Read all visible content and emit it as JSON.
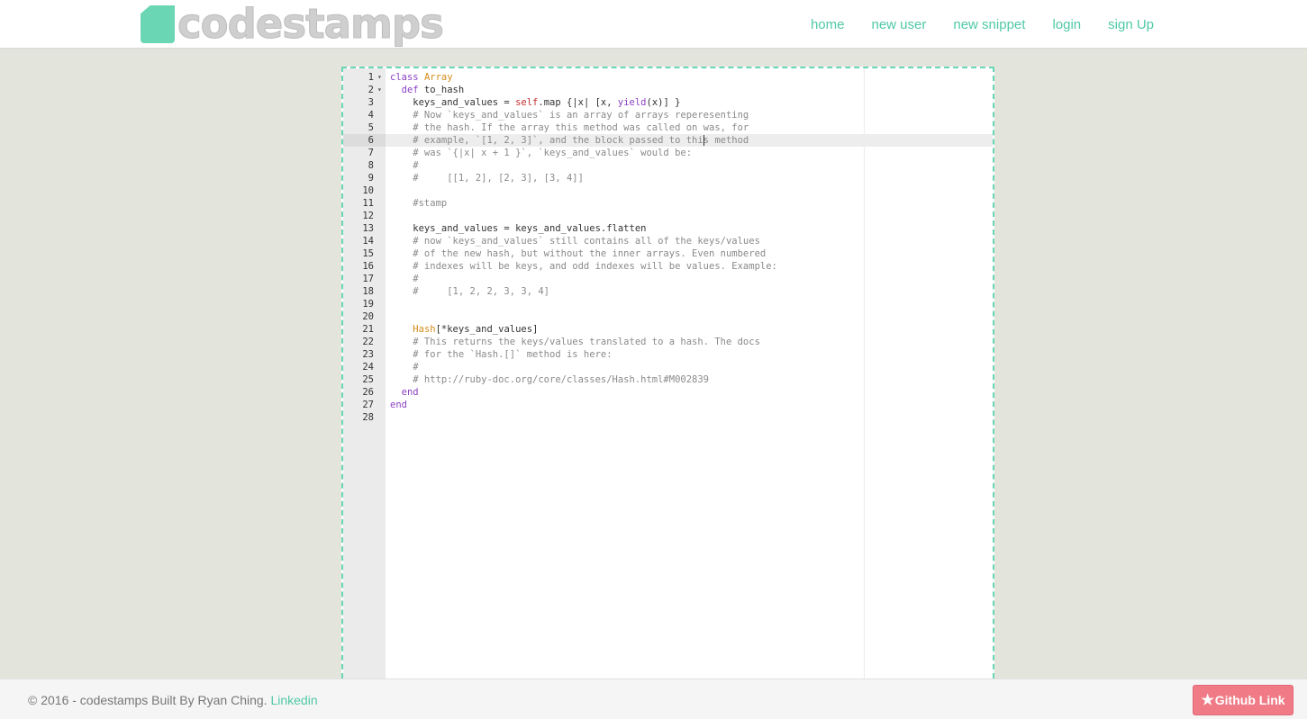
{
  "brand": {
    "name": "codestamps"
  },
  "nav": {
    "items": [
      "home",
      "new user",
      "new snippet",
      "login",
      "sign Up"
    ]
  },
  "editor": {
    "language": "ruby",
    "active_line": 6,
    "lines": [
      "class Array",
      "  def to_hash",
      "    keys_and_values = self.map {|x| [x, yield(x)] }",
      "    # Now `keys_and_values` is an array of arrays reperesenting",
      "    # the hash. If the array this method was called on was, for",
      "    # example, `[1, 2, 3]`, and the block passed to this method",
      "    # was `{|x| x + 1 }`, `keys_and_values` would be:",
      "    #",
      "    #     [[1, 2], [2, 3], [3, 4]]",
      "",
      "    #stamp",
      "",
      "    keys_and_values = keys_and_values.flatten",
      "    # now `keys_and_values` still contains all of the keys/values",
      "    # of the new hash, but without the inner arrays. Even numbered",
      "    # indexes will be keys, and odd indexes will be values. Example:",
      "    #",
      "    #     [1, 2, 2, 3, 3, 4]",
      "",
      "",
      "    Hash[*keys_and_values]",
      "    # This returns the keys/values translated to a hash. The docs",
      "    # for the `Hash.[]` method is here:",
      "    #",
      "    # http://ruby-doc.org/core/classes/Hash.html#M002839",
      "  end",
      "end",
      ""
    ],
    "fold_lines": [
      1,
      2
    ]
  },
  "footer": {
    "copyright": "© 2016 - codestamps Built By Ryan Ching.",
    "link_label": "Linkedin",
    "github_label": "Github Link"
  },
  "colors": {
    "accent": "#4fc9a6",
    "logo_mark": "#6ad6b4",
    "github_button": "#f07a86",
    "page_background": "#e3e4dc"
  }
}
